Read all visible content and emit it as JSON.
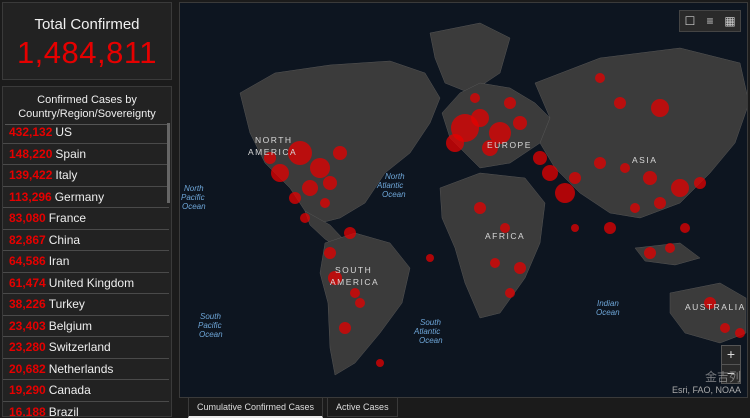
{
  "total": {
    "label": "Total Confirmed",
    "value": "1,484,811"
  },
  "list": {
    "header": "Confirmed Cases by Country/Region/Sovereignty",
    "rows": [
      {
        "count": "432,132",
        "name": "US"
      },
      {
        "count": "148,220",
        "name": "Spain"
      },
      {
        "count": "139,422",
        "name": "Italy"
      },
      {
        "count": "113,296",
        "name": "Germany"
      },
      {
        "count": "83,080",
        "name": "France"
      },
      {
        "count": "82,867",
        "name": "China"
      },
      {
        "count": "64,586",
        "name": "Iran"
      },
      {
        "count": "61,474",
        "name": "United Kingdom"
      },
      {
        "count": "38,226",
        "name": "Turkey"
      },
      {
        "count": "23,403",
        "name": "Belgium"
      },
      {
        "count": "23,280",
        "name": "Switzerland"
      },
      {
        "count": "20,682",
        "name": "Netherlands"
      },
      {
        "count": "19,290",
        "name": "Canada"
      },
      {
        "count": "16,188",
        "name": "Brazil"
      }
    ]
  },
  "map": {
    "labels": {
      "north_america": "NORTH AMERICA",
      "south_america": "SOUTH AMERICA",
      "europe": "EUROPE",
      "asia": "ASIA",
      "africa": "AFRICA",
      "australia": "AUSTRALIA",
      "north_pacific": "North Pacific Ocean",
      "north_atlantic": "North Atlantic Ocean",
      "south_pacific": "South Pacific Ocean",
      "south_atlantic": "South Atlantic Ocean",
      "indian": "Indian Ocean"
    },
    "tools": [
      "bookmark-icon",
      "legend-icon",
      "basemap-icon"
    ],
    "zoom_in": "+",
    "zoom_out": "−",
    "attribution": "Esri, FAO, NOAA",
    "watermark": "金吉列",
    "colors": {
      "land": "#3b3b3b",
      "ocean": "#0d1520",
      "bubble": "#e60000"
    }
  },
  "tabs": [
    "Cumulative Confirmed Cases",
    "Active Cases"
  ]
}
